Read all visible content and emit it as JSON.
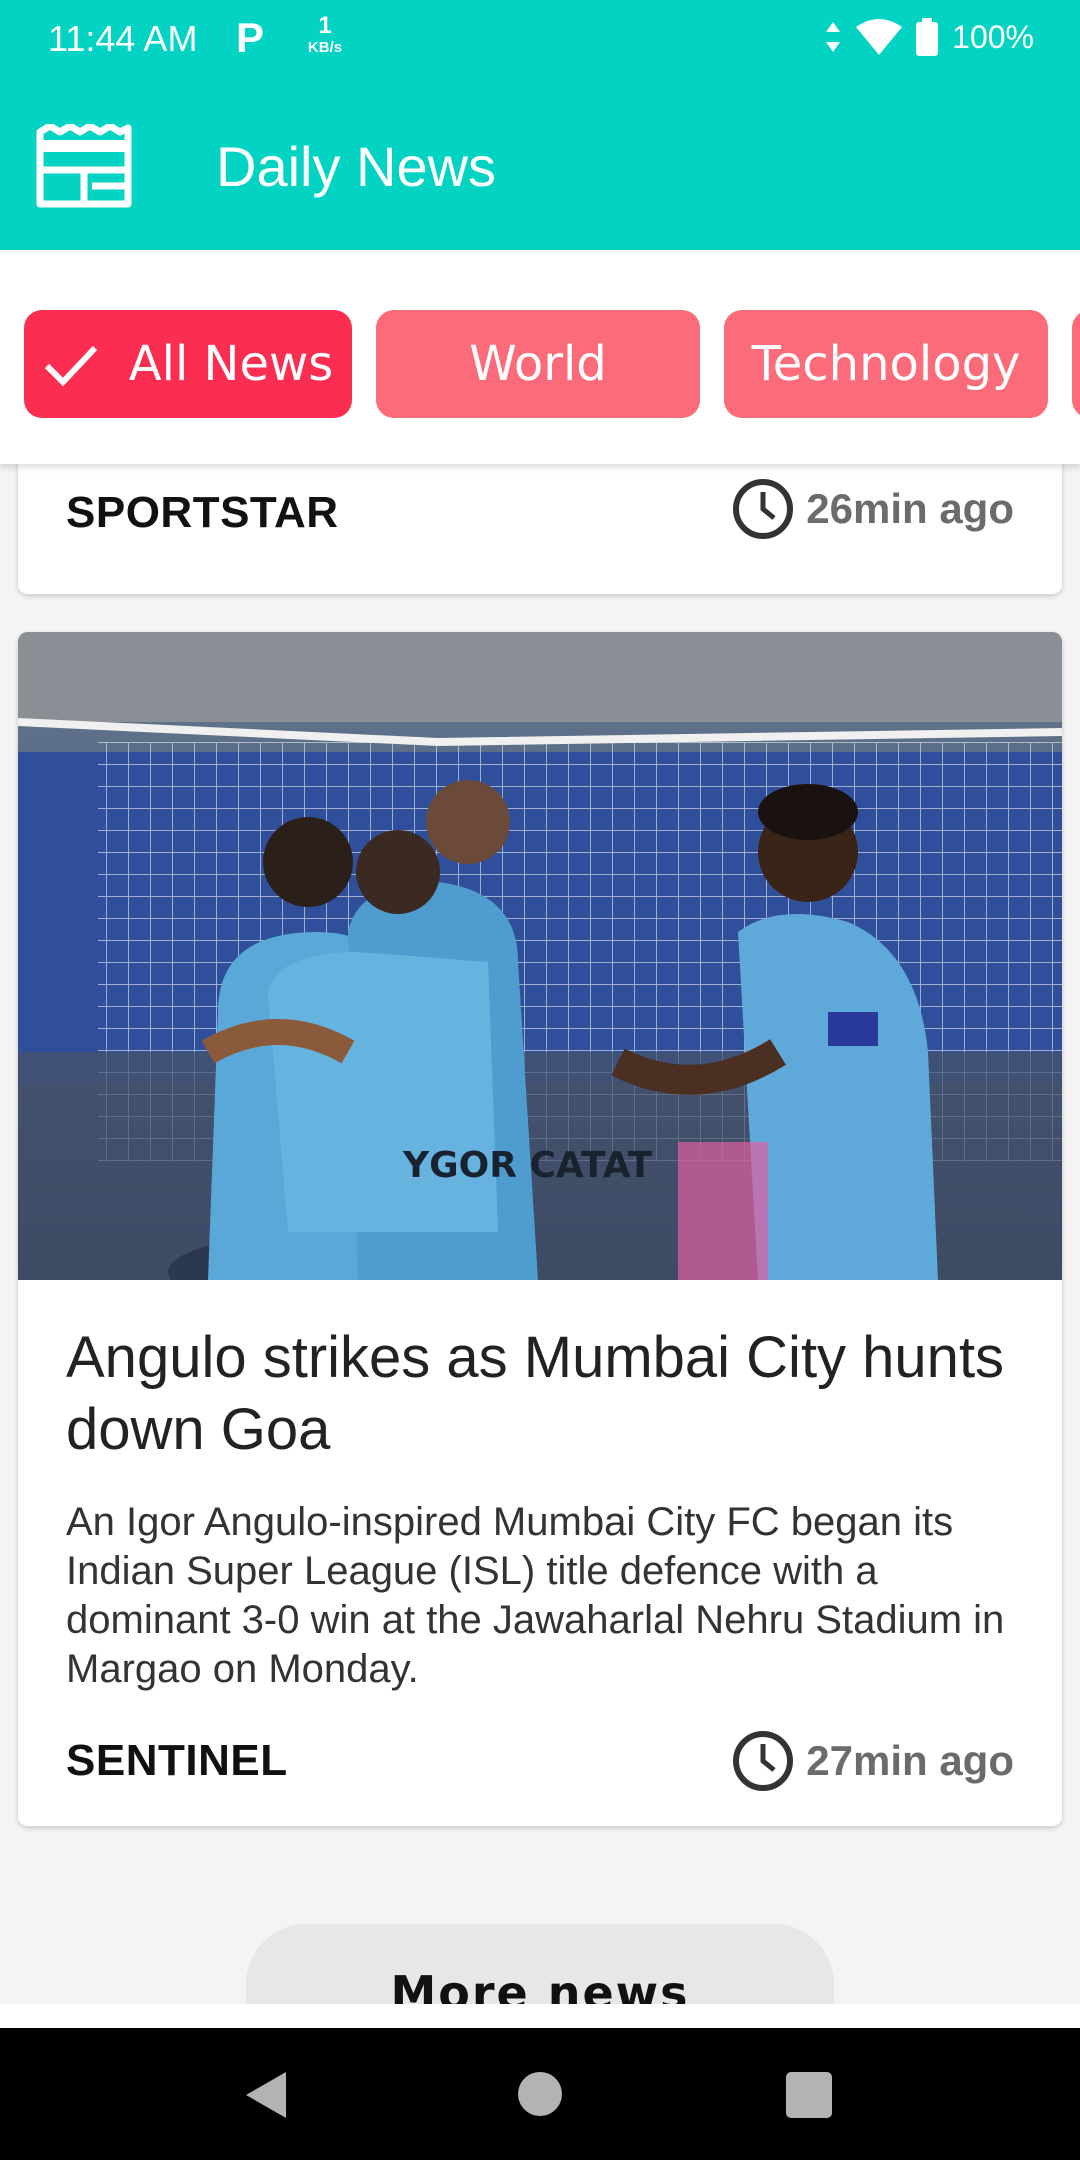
{
  "status_bar": {
    "time": "11:44 AM",
    "p_icon": "P",
    "speed_value": "1",
    "speed_unit": "KB/s",
    "battery": "100%"
  },
  "app_bar": {
    "title": "Daily News",
    "icon": "newspaper-icon"
  },
  "chips": [
    {
      "label": "All News",
      "selected": true
    },
    {
      "label": "World",
      "selected": false
    },
    {
      "label": "Technology",
      "selected": false
    }
  ],
  "articles": [
    {
      "source": "SPORTSTAR",
      "time": "26min ago"
    },
    {
      "headline": "Angulo strikes as Mumbai City hunts down Goa",
      "description": "An Igor Angulo-inspired Mumbai City FC began its Indian Super League (ISL) title defence with a dominant 3-0 win at the Jawaharlal Nehru Stadium in Margao on Monday.",
      "source": "SENTINEL",
      "time": "27min ago",
      "image_caption": "YGOR CATAT"
    }
  ],
  "more_button": "More news",
  "colors": {
    "primary": "#03d3c2",
    "chip_active": "#fb2e52",
    "chip_inactive": "#fb6b7a"
  }
}
